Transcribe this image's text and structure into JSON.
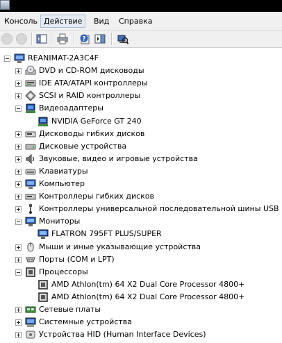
{
  "menu": [
    "Консоль",
    "Действие",
    "Вид",
    "Справка"
  ],
  "toolbar_icons": [
    "back-icon",
    "forward-icon",
    "show-hide-tree-icon",
    "print-icon",
    "help-icon",
    "properties-icon",
    "scan-hardware-icon"
  ],
  "tree": {
    "root": "REANIMAT-2A3C4F",
    "items": [
      {
        "label": "DVD и CD-ROM дисководы",
        "expanded": false,
        "icon": "dvd-drive-icon",
        "children": []
      },
      {
        "label": "IDE ATA/ATAPI контроллеры",
        "expanded": false,
        "icon": "ide-controller-icon",
        "children": []
      },
      {
        "label": "SCSI и RAID контроллеры",
        "expanded": false,
        "icon": "scsi-controller-icon",
        "children": []
      },
      {
        "label": "Видеоадаптеры",
        "expanded": true,
        "icon": "display-adapter-icon",
        "children": [
          {
            "label": "NVIDIA GeForce GT 240",
            "icon": "display-adapter-icon"
          }
        ]
      },
      {
        "label": "Дисководы гибких дисков",
        "expanded": false,
        "icon": "floppy-drive-icon",
        "children": []
      },
      {
        "label": "Дисковые устройства",
        "expanded": false,
        "icon": "disk-drive-icon",
        "children": []
      },
      {
        "label": "Звуковые, видео и игровые устройства",
        "expanded": false,
        "icon": "sound-device-icon",
        "children": []
      },
      {
        "label": "Клавиатуры",
        "expanded": false,
        "icon": "keyboard-icon",
        "children": []
      },
      {
        "label": "Компьютер",
        "expanded": false,
        "icon": "computer-icon",
        "children": []
      },
      {
        "label": "Контроллеры гибких дисков",
        "expanded": false,
        "icon": "floppy-controller-icon",
        "children": []
      },
      {
        "label": "Контроллеры универсальной последовательной шины USB",
        "expanded": false,
        "icon": "usb-icon",
        "children": []
      },
      {
        "label": "Мониторы",
        "expanded": true,
        "icon": "monitor-icon",
        "children": [
          {
            "label": "FLATRON 795FT PLUS/SUPER",
            "icon": "monitor-icon"
          }
        ]
      },
      {
        "label": "Мыши и иные указывающие устройства",
        "expanded": false,
        "icon": "mouse-icon",
        "children": []
      },
      {
        "label": "Порты (COM и LPT)",
        "expanded": false,
        "icon": "port-icon",
        "children": []
      },
      {
        "label": "Процессоры",
        "expanded": true,
        "icon": "processor-icon",
        "children": [
          {
            "label": "AMD Athlon(tm) 64 X2 Dual Core Processor 4800+",
            "icon": "processor-icon"
          },
          {
            "label": "AMD Athlon(tm) 64 X2 Dual Core Processor 4800+",
            "icon": "processor-icon"
          }
        ]
      },
      {
        "label": "Сетевые платы",
        "expanded": false,
        "icon": "network-adapter-icon",
        "children": []
      },
      {
        "label": "Системные устройства",
        "expanded": false,
        "icon": "system-device-icon",
        "children": []
      },
      {
        "label": "Устройства HID (Human Interface Devices)",
        "expanded": false,
        "icon": "hid-icon",
        "children": []
      }
    ]
  }
}
